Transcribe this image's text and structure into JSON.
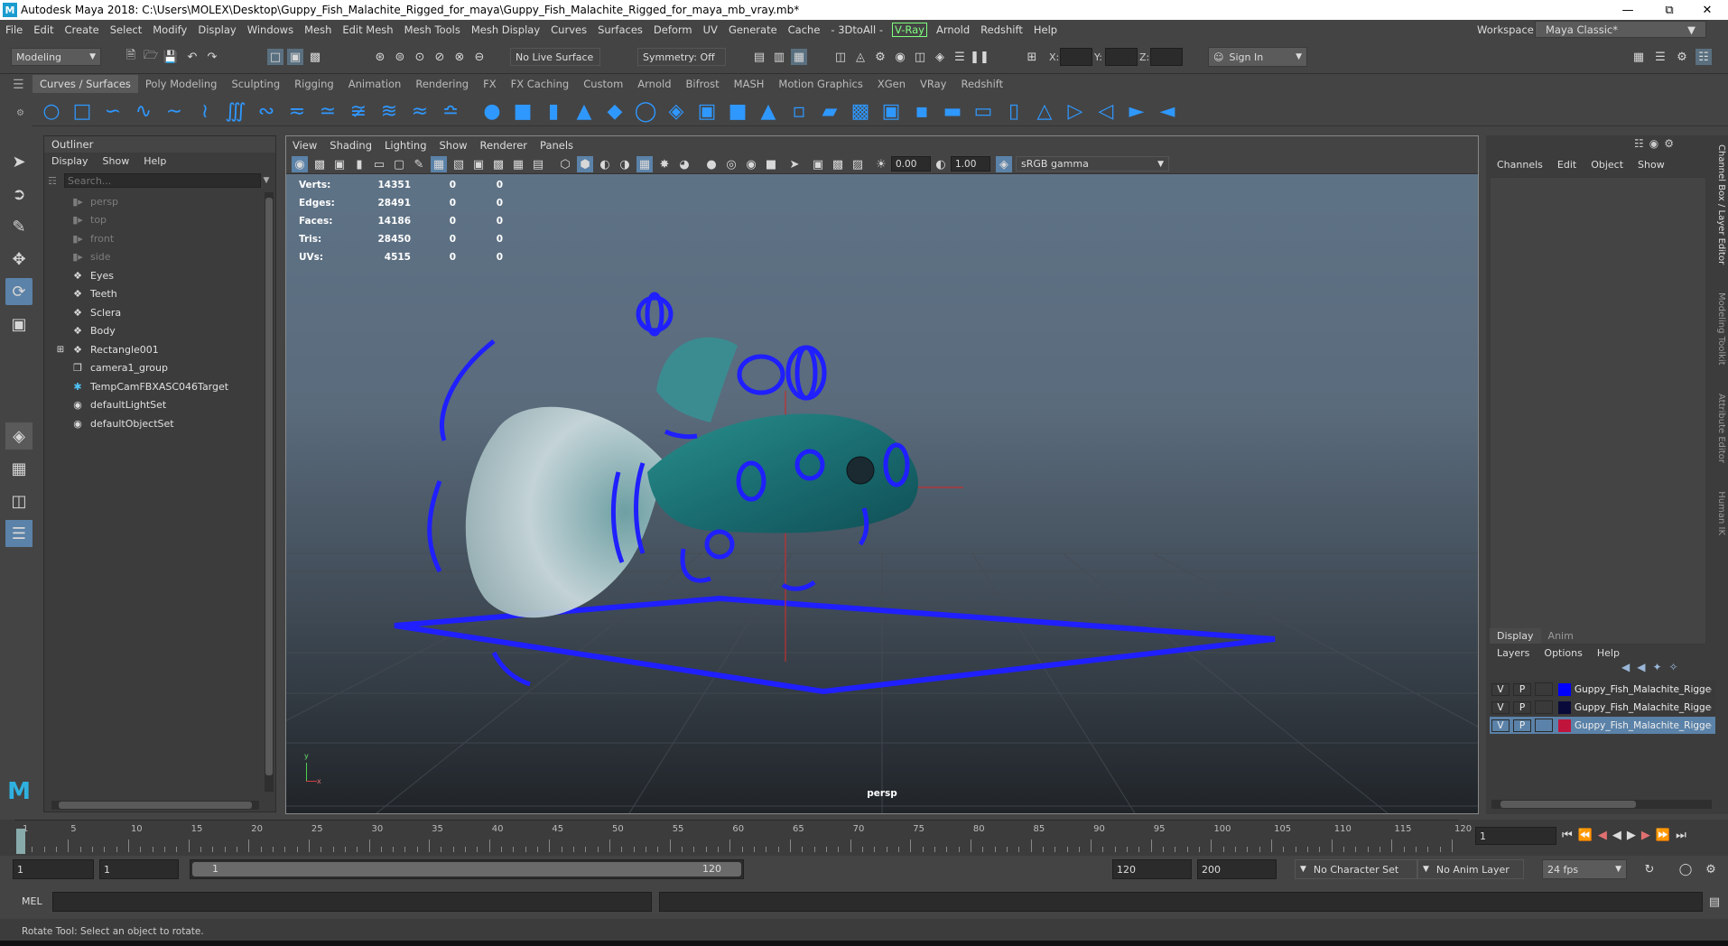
{
  "window": {
    "title": "Autodesk Maya 2018: C:\\Users\\MOLEX\\Desktop\\Guppy_Fish_Malachite_Rigged_for_maya\\Guppy_Fish_Malachite_Rigged_for_maya_mb_vray.mb*",
    "logo": "M"
  },
  "menubar": {
    "items": [
      "File",
      "Edit",
      "Create",
      "Select",
      "Modify",
      "Display",
      "Windows",
      "Mesh",
      "Edit Mesh",
      "Mesh Tools",
      "Mesh Display",
      "Curves",
      "Surfaces",
      "Deform",
      "UV",
      "Generate",
      "Cache",
      "- 3DtoAll -"
    ],
    "vray": "V-Ray",
    "items2": [
      "Arnold",
      "Redshift",
      "Help"
    ],
    "workspace_label": "Workspace :",
    "workspace_value": "Maya Classic*"
  },
  "statusline": {
    "mode": "Modeling",
    "live_surface": "No Live Surface",
    "symmetry": "Symmetry: Off",
    "x_label": "X:",
    "y_label": "Y:",
    "z_label": "Z:",
    "sign_in": "Sign In"
  },
  "shelf": {
    "tabs": [
      "Curves / Surfaces",
      "Poly Modeling",
      "Sculpting",
      "Rigging",
      "Animation",
      "Rendering",
      "FX",
      "FX Caching",
      "Custom",
      "Arnold",
      "Bifrost",
      "MASH",
      "Motion Graphics",
      "XGen",
      "VRay",
      "Redshift"
    ]
  },
  "outliner": {
    "title": "Outliner",
    "menu": [
      "Display",
      "Show",
      "Help"
    ],
    "search_placeholder": "Search...",
    "items": [
      {
        "label": "persp",
        "dim": true,
        "icon": "camera-icon"
      },
      {
        "label": "top",
        "dim": true,
        "icon": "camera-icon"
      },
      {
        "label": "front",
        "dim": true,
        "icon": "camera-icon"
      },
      {
        "label": "side",
        "dim": true,
        "icon": "camera-icon"
      },
      {
        "label": "Eyes",
        "dim": false,
        "icon": "mesh-icon"
      },
      {
        "label": "Teeth",
        "dim": false,
        "icon": "mesh-icon"
      },
      {
        "label": "Sclera",
        "dim": false,
        "icon": "mesh-icon"
      },
      {
        "label": "Body",
        "dim": false,
        "icon": "mesh-icon"
      },
      {
        "label": "Rectangle001",
        "dim": false,
        "icon": "mesh-icon",
        "expand": true
      },
      {
        "label": "camera1_group",
        "dim": false,
        "icon": "group-icon"
      },
      {
        "label": "TempCamFBXASC046Target",
        "dim": false,
        "icon": "locator-icon"
      },
      {
        "label": "defaultLightSet",
        "dim": false,
        "icon": "set-icon"
      },
      {
        "label": "defaultObjectSet",
        "dim": false,
        "icon": "set-icon"
      }
    ]
  },
  "viewport": {
    "menu": [
      "View",
      "Shading",
      "Lighting",
      "Show",
      "Renderer",
      "Panels"
    ],
    "exposure": "0.00",
    "gamma": "1.00",
    "color_space": "sRGB gamma",
    "camera_label": "persp",
    "hud": [
      {
        "label": "Verts:",
        "a": "14351",
        "b": "0",
        "c": "0"
      },
      {
        "label": "Edges:",
        "a": "28491",
        "b": "0",
        "c": "0"
      },
      {
        "label": "Faces:",
        "a": "14186",
        "b": "0",
        "c": "0"
      },
      {
        "label": "Tris:",
        "a": "28450",
        "b": "0",
        "c": "0"
      },
      {
        "label": "UVs:",
        "a": "4515",
        "b": "0",
        "c": "0"
      }
    ],
    "axis_y": "y",
    "axis_x": "x"
  },
  "channelbox": {
    "menu": [
      "Channels",
      "Edit",
      "Object",
      "Show"
    ],
    "side_tabs": [
      "Channel Box / Layer Editor",
      "Modeling Toolkit",
      "Attribute Editor",
      "Human IK"
    ],
    "layer_tabs": [
      "Display",
      "Anim"
    ],
    "layer_menu": [
      "Layers",
      "Options",
      "Help"
    ],
    "layers": [
      {
        "v": "V",
        "p": "P",
        "color": "#0000ff",
        "name": "Guppy_Fish_Malachite_Rigged",
        "selected": false
      },
      {
        "v": "V",
        "p": "P",
        "color": "#0a0a3a",
        "name": "Guppy_Fish_Malachite_Rigged",
        "selected": false
      },
      {
        "v": "V",
        "p": "P",
        "color": "#c0143c",
        "name": "Guppy_Fish_Malachite_Rigged",
        "selected": true
      }
    ]
  },
  "timeline": {
    "ticks": [
      "1",
      "5",
      "10",
      "15",
      "20",
      "25",
      "30",
      "35",
      "40",
      "45",
      "50",
      "55",
      "60",
      "65",
      "70",
      "75",
      "80",
      "85",
      "90",
      "95",
      "100",
      "105",
      "110",
      "115",
      "120"
    ],
    "current_frame": "1"
  },
  "range": {
    "start": "1",
    "start2": "1",
    "slider_start": "1",
    "slider_end": "120",
    "end": "120",
    "end2": "200",
    "character_set": "No Character Set",
    "anim_layer": "No Anim Layer",
    "fps": "24 fps"
  },
  "cmdline": {
    "label": "MEL"
  },
  "helpline": {
    "text": "Rotate Tool: Select an object to rotate."
  }
}
